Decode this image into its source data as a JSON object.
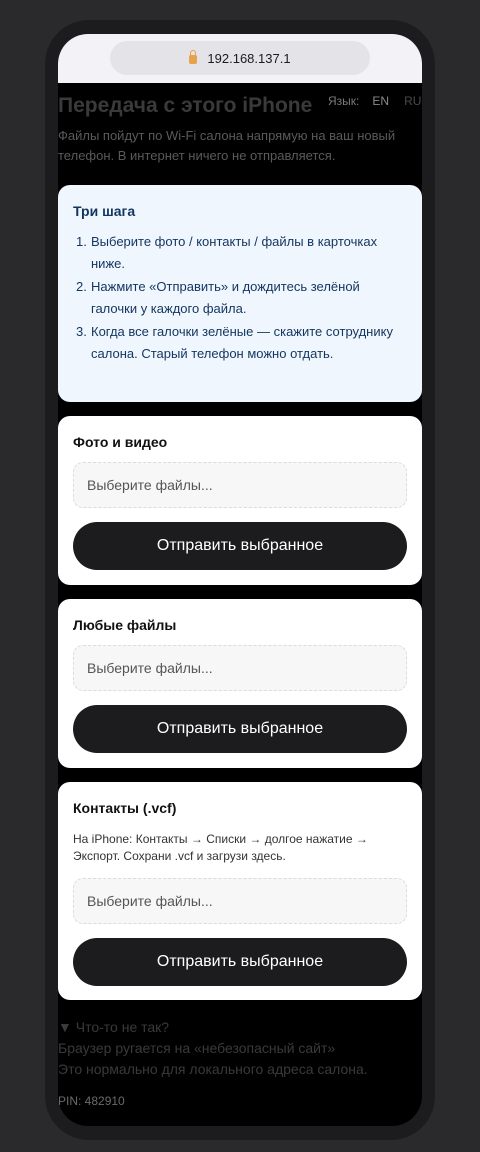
{
  "browser": {
    "url": "192.168.137.1"
  },
  "lang": {
    "label": "Язык:",
    "en": "EN",
    "ru": "RU"
  },
  "header": {
    "title": "Передача с этого iPhone",
    "subtitle": "Файлы пойдут по Wi-Fi салона напрямую на ваш новый телефон. В интернет ничего не отправляется."
  },
  "steps": {
    "title": "Три шага",
    "items": [
      {
        "num": "1.",
        "text": "Выберите фото / контакты / файлы в карточках ниже."
      },
      {
        "num": "2.",
        "text": "Нажмите «Отправить» и дождитесь зелёной галочки у каждого файла."
      },
      {
        "num": "3.",
        "text": "Когда все галочки зелёные — скажите сотруднику салона. Старый телефон можно отдать."
      }
    ]
  },
  "cards": [
    {
      "title": "Фото и видео",
      "placeholder": "Выберите файлы...",
      "button": "Отправить выбранное"
    },
    {
      "title": "Любые файлы",
      "placeholder": "Выберите файлы...",
      "button": "Отправить выбранное"
    },
    {
      "title": "Контакты (.vcf)",
      "note": "На iPhone: Контакты → Списки → долгое нажатие → Экспорт. Сохрани .vcf и загрузи здесь.",
      "placeholder": "Выберите файлы...",
      "button": "Отправить выбранное"
    }
  ],
  "troubleshoot": {
    "summary": "▼ Что-то не так?",
    "line1": "Браузер ругается на «небезопасный сайт»",
    "line2": "Это нормально для локального адреса салона."
  },
  "pin": "PIN: 482910"
}
